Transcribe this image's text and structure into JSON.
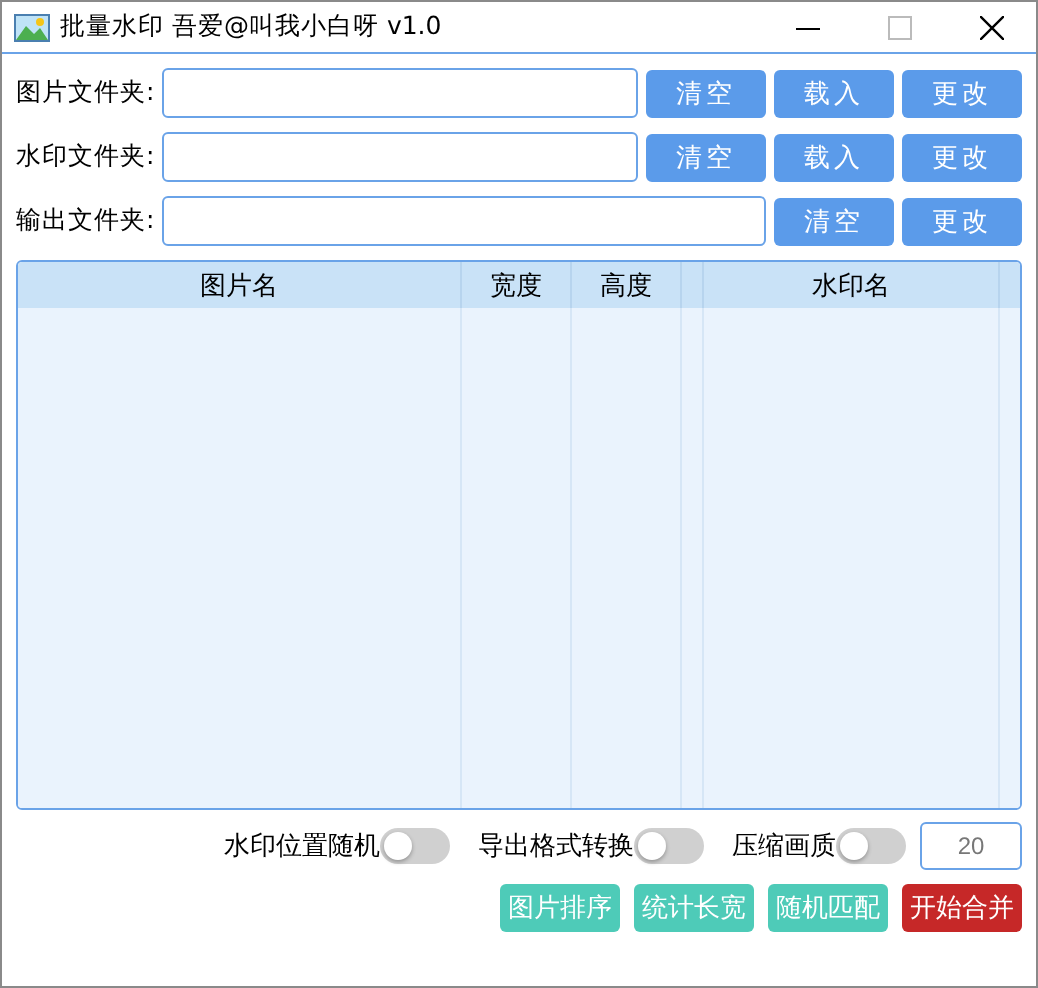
{
  "window": {
    "title": "批量水印 吾爱@叫我小白呀 v1.0"
  },
  "folders": [
    {
      "label": "图片文件夹:",
      "buttons": [
        "清空",
        "载入",
        "更改"
      ]
    },
    {
      "label": "水印文件夹:",
      "buttons": [
        "清空",
        "载入",
        "更改"
      ]
    },
    {
      "label": "输出文件夹:",
      "buttons": [
        "清空",
        "更改"
      ]
    }
  ],
  "table": {
    "columns": [
      "图片名",
      "宽度",
      "高度",
      "水印名"
    ]
  },
  "options": [
    {
      "label": "水印位置随机",
      "on": false
    },
    {
      "label": "导出格式转换",
      "on": false
    },
    {
      "label": "压缩画质",
      "on": false
    }
  ],
  "quality_field": {
    "value": "20"
  },
  "actions": [
    {
      "label": "图片排序",
      "kind": "normal"
    },
    {
      "label": "统计长宽",
      "kind": "normal"
    },
    {
      "label": "随机匹配",
      "kind": "normal"
    },
    {
      "label": "开始合并",
      "kind": "primary"
    }
  ]
}
